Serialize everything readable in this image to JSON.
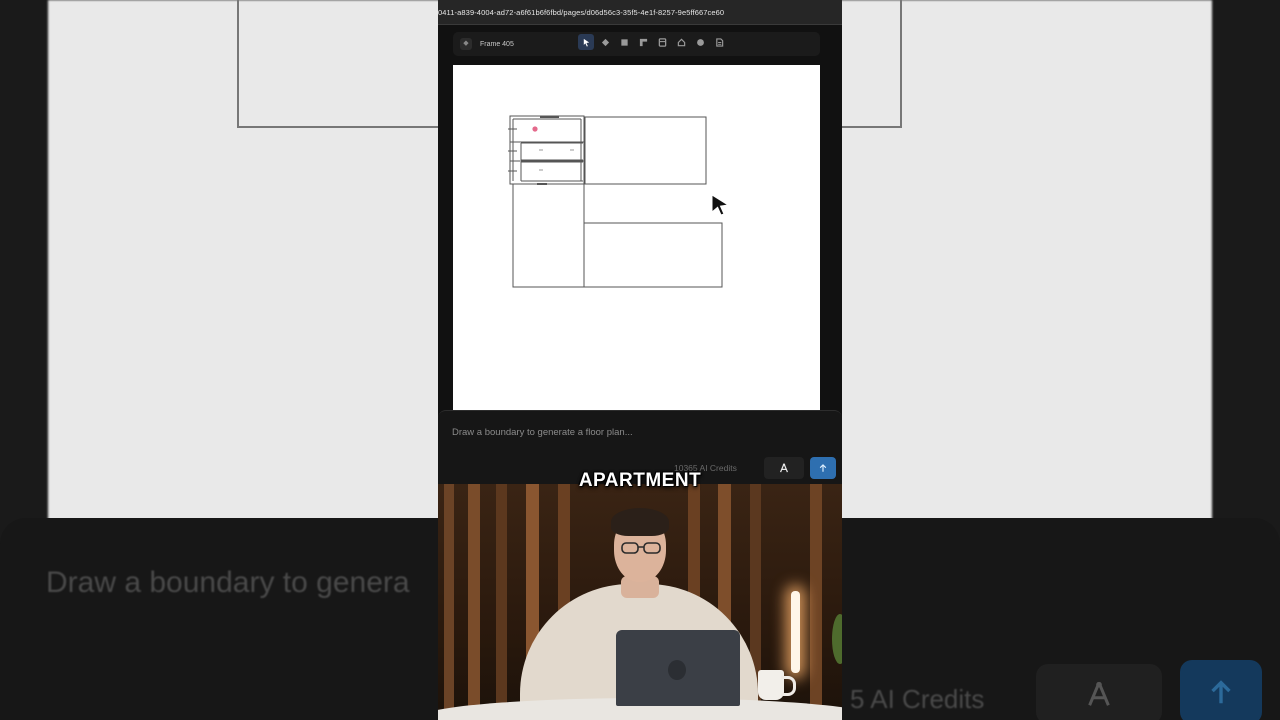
{
  "browser": {
    "url": "0411-a839-4004-ad72-a6f61b6f6fbd/pages/d06d56c3-35f5-4e1f-8257-9e5ff667ce60"
  },
  "toolbar": {
    "frame_label": "Frame 405",
    "tools": [
      {
        "name": "select-tool",
        "icon": "cursor-arrow-icon",
        "active": true
      },
      {
        "name": "component-tool",
        "icon": "diamond-icon"
      },
      {
        "name": "rectangle-tool",
        "icon": "square-icon"
      },
      {
        "name": "wall-tool",
        "icon": "wall-icon"
      },
      {
        "name": "door-tool",
        "icon": "door-icon"
      },
      {
        "name": "room-tool",
        "icon": "room-icon"
      },
      {
        "name": "comment-tool",
        "icon": "comment-icon"
      },
      {
        "name": "page-tool",
        "icon": "page-icon"
      }
    ]
  },
  "prompt": {
    "placeholder": "Draw a boundary to generate a floor plan...",
    "credits": "10365 AI Credits"
  },
  "video": {
    "caption": "APARTMENT"
  },
  "background_blur": {
    "prompt_text": "Draw a boundary to genera",
    "credits_text": "5 AI Credits"
  },
  "colors": {
    "accent_blue": "#2e6fb0",
    "canvas_bg": "#ffffff",
    "panel_bg": "#161616"
  }
}
